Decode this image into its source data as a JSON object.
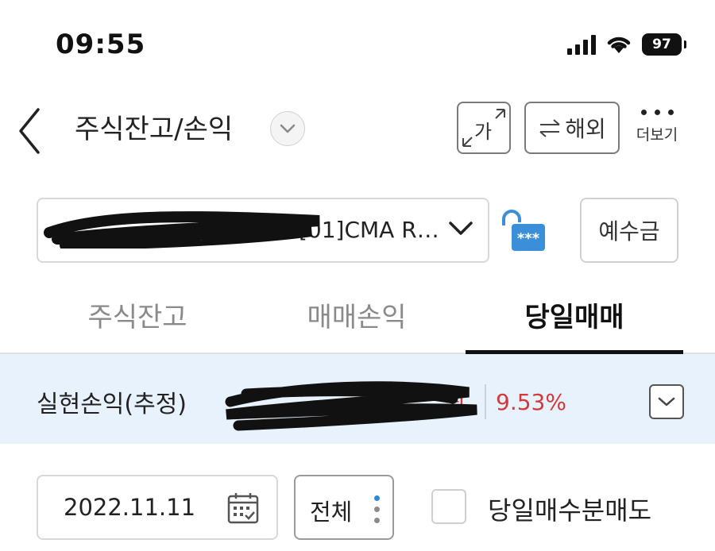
{
  "status_bar": {
    "time": "09:55",
    "battery": "97",
    "icons": [
      "cellular-signal-icon",
      "wifi-icon",
      "battery-icon"
    ]
  },
  "header": {
    "title": "주식잔고/손익",
    "font_button_label": "가",
    "overseas_button_label": "해외",
    "more_label": "더보기"
  },
  "account": {
    "display_text": "[01]CMA R…",
    "deposit_button_label": "예수금"
  },
  "tabs": [
    {
      "label": "주식잔고",
      "active": false
    },
    {
      "label": "매매손익",
      "active": false
    },
    {
      "label": "당일매매",
      "active": true
    }
  ],
  "profit": {
    "label": "실현손익(추정)",
    "amount_suffix": "원",
    "percent": "9.53%"
  },
  "filters": {
    "date": "2022.11.11",
    "type_selected": "전체",
    "checkbox_label": "당일매수분매도",
    "checkbox_checked": false
  },
  "colors": {
    "accent_red": "#d23a3a",
    "profit_bg": "#e8f2fc",
    "lock_blue": "#3b8fd9",
    "active_tab": "#111111"
  }
}
